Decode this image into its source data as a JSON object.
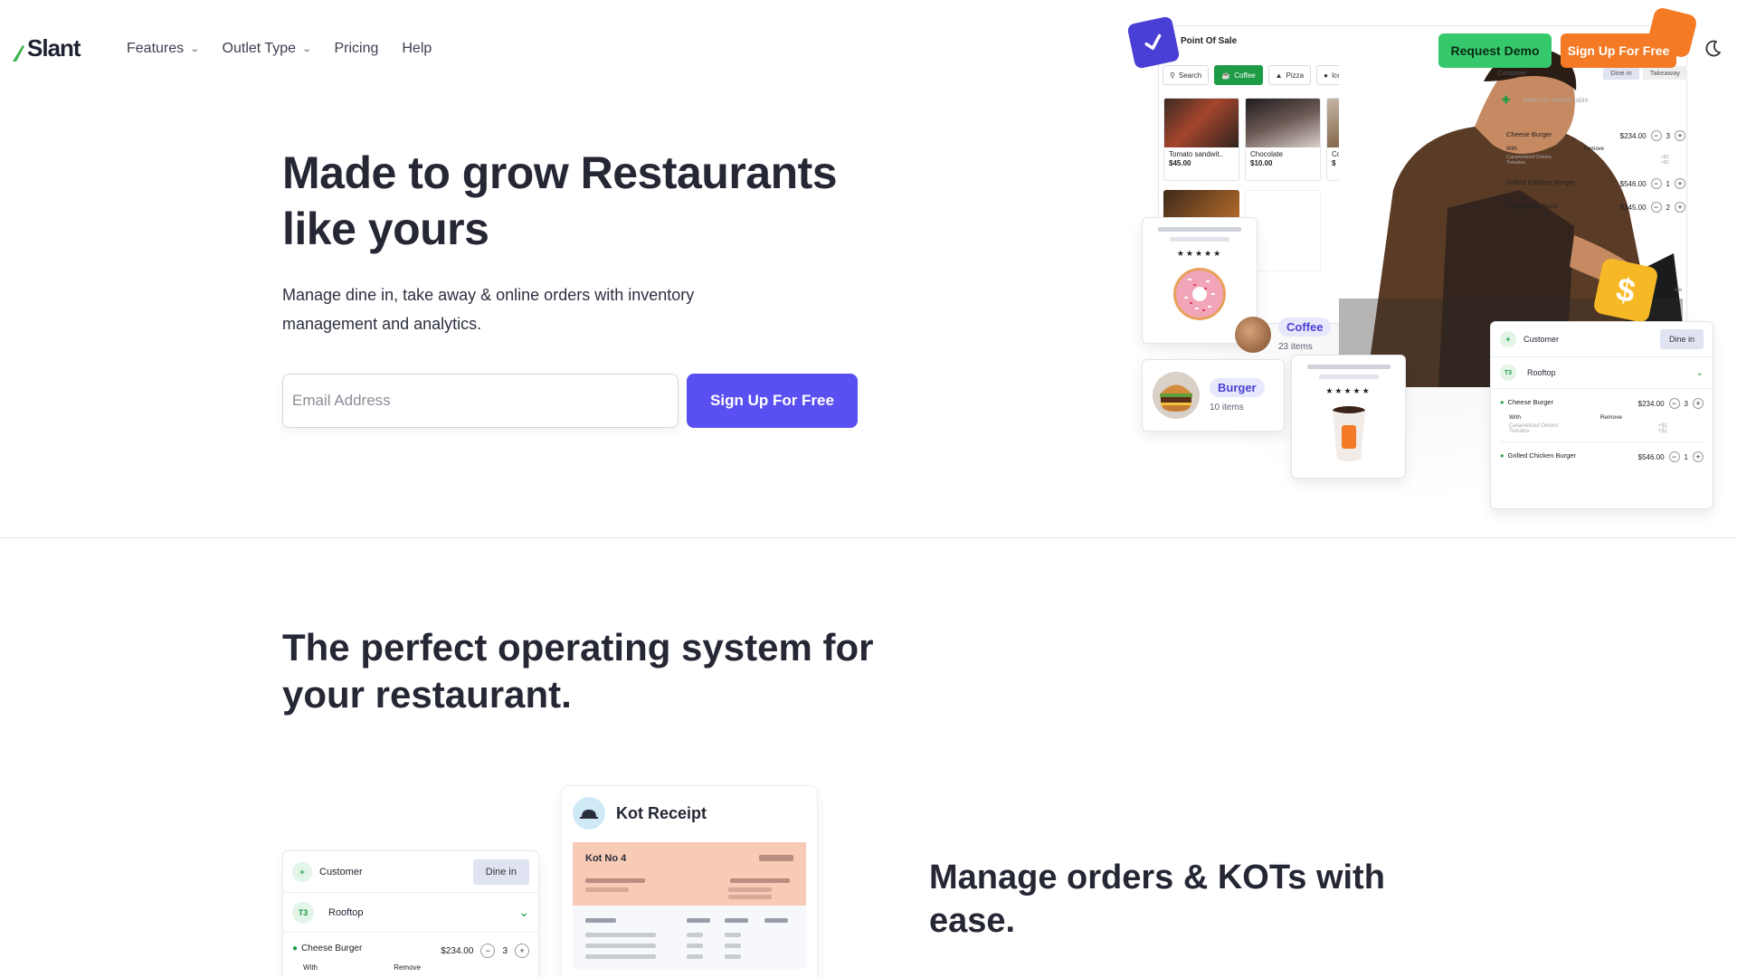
{
  "brand": {
    "name": "Slant",
    "logo_color": "#37b34a"
  },
  "nav": {
    "items": [
      {
        "label": "Features",
        "has_dropdown": true
      },
      {
        "label": "Outlet Type",
        "has_dropdown": true
      },
      {
        "label": "Pricing",
        "has_dropdown": false
      },
      {
        "label": "Help",
        "has_dropdown": false
      }
    ],
    "request_demo": "Request Demo",
    "sign_up": "Sign Up For Free",
    "theme_icon": "moon-icon"
  },
  "hero": {
    "title_line1": "Made to grow Restaurants",
    "title_line2": "like yours",
    "subtitle_line1": "Manage dine in, take away & online orders with inventory",
    "subtitle_line2": "management and analytics.",
    "email_placeholder": "Email Address",
    "email_value": "",
    "cta": "Sign Up For Free",
    "accent": "#5a4ff0"
  },
  "pos_mock": {
    "title": "Point Of Sale",
    "tabs": [
      "Search",
      "Coffee",
      "Pizza",
      "Ice Cream"
    ],
    "active_tab": "Coffee",
    "items": [
      {
        "name": "Tomato sandwit..",
        "price": "$45.00"
      },
      {
        "name": "Chocolate",
        "price": "$10.00"
      },
      {
        "name": "Cor",
        "price": "$"
      }
    ],
    "side_panel": {
      "customer": "Customer",
      "dine_in": "Dine in",
      "takeaway": "Takeaway",
      "search_placeholder": "Select or search table",
      "lines": [
        {
          "name": "Cheese Burger",
          "price": "$234.00",
          "qty": "3",
          "with": "With",
          "remove": "Remove",
          "mod1": "Caramelized Onions",
          "mod1_price": "+$1",
          "mod2": "Tomatos",
          "mod2_price": "+$2"
        },
        {
          "name": "Grilled Chicken Burger",
          "price": "$546.00",
          "qty": "1"
        },
        {
          "name": "Margherita Pizza",
          "price": "$145.00",
          "qty": "2"
        }
      ],
      "note": "ote"
    },
    "categories": [
      {
        "name": "Coffee",
        "count": "23 items"
      },
      {
        "name": "Burger",
        "count": "10 items"
      }
    ],
    "stars": "★★★★★",
    "dollar": "$",
    "order_card": {
      "customer": "Customer",
      "dine_in": "Dine in",
      "table_code": "T3",
      "table_name": "Rooftop",
      "lines": [
        {
          "name": "Cheese Burger",
          "price": "$234.00",
          "qty": "3",
          "with": "With",
          "remove": "Remove",
          "mod1": "Caramelized Onions",
          "mod1_price": "+$1",
          "mod2": "Tomatos",
          "mod2_price": "+$2"
        },
        {
          "name": "Grilled Chicken Burger",
          "price": "$546.00",
          "qty": "1"
        }
      ]
    }
  },
  "section2": {
    "title_line1": "The perfect operating system for",
    "title_line2": "your restaurant.",
    "feature_title_line1": "Manage orders & KOTs with",
    "feature_title_line2": "ease.",
    "customer_card": {
      "customer": "Customer",
      "dine_in": "Dine in",
      "table_code": "T3",
      "table_name": "Rooftop",
      "line_name": "Cheese Burger",
      "line_price": "$234.00",
      "line_qty": "3",
      "with": "With",
      "remove": "Remove"
    },
    "kot": {
      "title": "Kot Receipt",
      "number": "Kot No 4"
    }
  }
}
